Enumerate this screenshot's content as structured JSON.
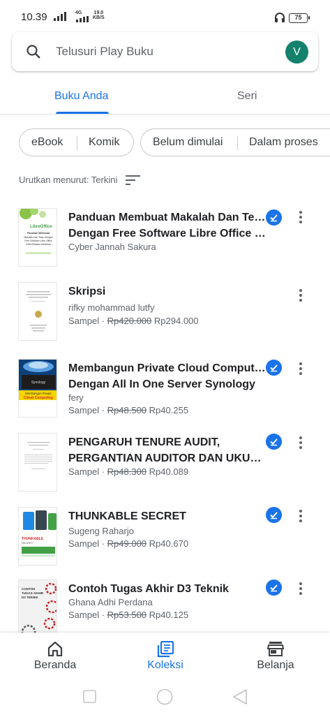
{
  "status_bar": {
    "time": "10.39",
    "network": "4G",
    "speed_value": "19.0",
    "speed_unit": "KB/S",
    "battery": "75"
  },
  "search": {
    "placeholder": "Telusuri Play Buku",
    "avatar_initial": "V"
  },
  "tabs": [
    {
      "label": "Buku Anda",
      "active": true
    },
    {
      "label": "Seri",
      "active": false
    }
  ],
  "filters": {
    "type_chips": [
      "eBook",
      "Komik"
    ],
    "status_chips": [
      "Belum dimulai",
      "Dalam proses"
    ]
  },
  "sort": {
    "label": "Urutkan menurut: Terkini"
  },
  "books": [
    {
      "title_lines": [
        "Panduan Membuat Makalah Dan Tesis",
        "Dengan Free Software Libre Office Ed..."
      ],
      "author": "Cyber Jannah Sakura",
      "sample_label": "",
      "old_price": "",
      "price": "",
      "downloaded": true,
      "cover_text": [
        "LibreOffice",
        "Panduan Membuat",
        "Makalah Dan Tesis Dengan",
        "Free Software Libre Office",
        "Edisi Bahasa Indonesia"
      ]
    },
    {
      "title_lines": [
        "Skripsi"
      ],
      "author": "rifky mohammad lutfy",
      "sample_label": "Sampel ·",
      "old_price": "Rp420.000",
      "price": "Rp294.000",
      "downloaded": false,
      "cover_text": []
    },
    {
      "title_lines": [
        "Membangun Private Cloud Computing",
        "Dengan All In One Server Synology"
      ],
      "author": "fery",
      "sample_label": "Sampel ·",
      "old_price": "Rp48.500",
      "price": "Rp40.255",
      "downloaded": true,
      "cover_text": [
        "Synology",
        "Membangun Private",
        "Cloud Computing"
      ]
    },
    {
      "title_lines": [
        "PENGARUH TENURE AUDIT,",
        "PERGANTIAN AUDITOR DAN UKURA..."
      ],
      "author": "",
      "sample_label": "Sampel ·",
      "old_price": "Rp48.300",
      "price": "Rp40.089",
      "downloaded": true,
      "cover_text": []
    },
    {
      "title_lines": [
        "THUNKABLE SECRET"
      ],
      "author": "Sugeng Raharjo",
      "sample_label": "Sampel ·",
      "old_price": "Rp49.000",
      "price": "Rp40.670",
      "downloaded": true,
      "cover_text": [
        "THUNKABLE",
        "SECRET"
      ]
    },
    {
      "title_lines": [
        "Contoh Tugas Akhir D3 Teknik"
      ],
      "author": "Ghana Adhi Perdana",
      "sample_label": "Sampel ·",
      "old_price": "Rp53.500",
      "price": "Rp40.125",
      "downloaded": true,
      "cover_text": [
        "CONTOH",
        "TUGAS AKHIR",
        "D3 TEKNIK"
      ]
    }
  ],
  "bottom_nav": [
    {
      "label": "Beranda",
      "icon": "home-icon",
      "active": false
    },
    {
      "label": "Koleksi",
      "icon": "library-icon",
      "active": true
    },
    {
      "label": "Belanja",
      "icon": "store-icon",
      "active": false
    }
  ],
  "colors": {
    "accent": "#1a73e8",
    "avatar": "#13816b",
    "text_secondary": "#5f6368"
  }
}
